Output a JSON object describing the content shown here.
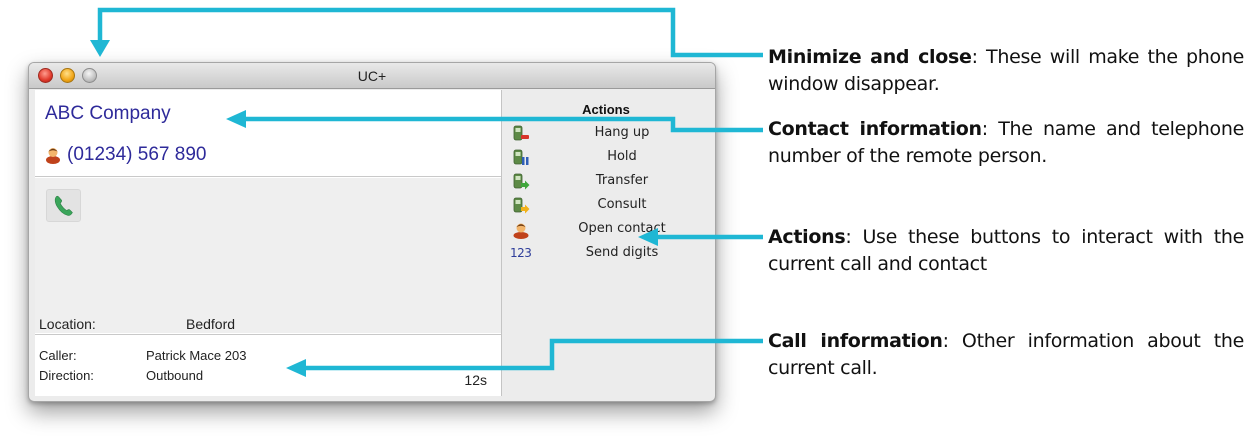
{
  "window": {
    "title": "UC+",
    "controls": [
      "close-button",
      "minimize-button",
      "zoom-button"
    ]
  },
  "contact": {
    "company": "ABC Company",
    "phone": "(01234) 567 890"
  },
  "call": {
    "location_label": "Location:",
    "location_value": "Bedford"
  },
  "info": {
    "caller_label": "Caller:",
    "caller_value": "Patrick Mace 203",
    "direction_label": "Direction:",
    "direction_value": "Outbound",
    "duration": "12s"
  },
  "actions": {
    "heading": "Actions",
    "items": [
      {
        "label": "Hang up",
        "icon": "hang-up-icon"
      },
      {
        "label": "Hold",
        "icon": "hold-icon"
      },
      {
        "label": "Transfer",
        "icon": "transfer-icon"
      },
      {
        "label": "Consult",
        "icon": "consult-icon"
      },
      {
        "label": "Open contact",
        "icon": "contact-icon"
      },
      {
        "label": "Send digits",
        "icon": "digits-icon"
      }
    ],
    "digits_glyph": "123"
  },
  "annotations": [
    {
      "title": "Minimize and close",
      "text": ": These will make the phone window disappear."
    },
    {
      "title": "Contact information",
      "text": ": The name and telephone number of the remote person."
    },
    {
      "title": "Actions",
      "text": ": Use these buttons to interact with the current call and contact"
    },
    {
      "title": "Call information",
      "text": ": Other information about the current call."
    }
  ],
  "colors": {
    "arrow": "#1fb7d4",
    "contact_text": "#2e2a9a"
  }
}
